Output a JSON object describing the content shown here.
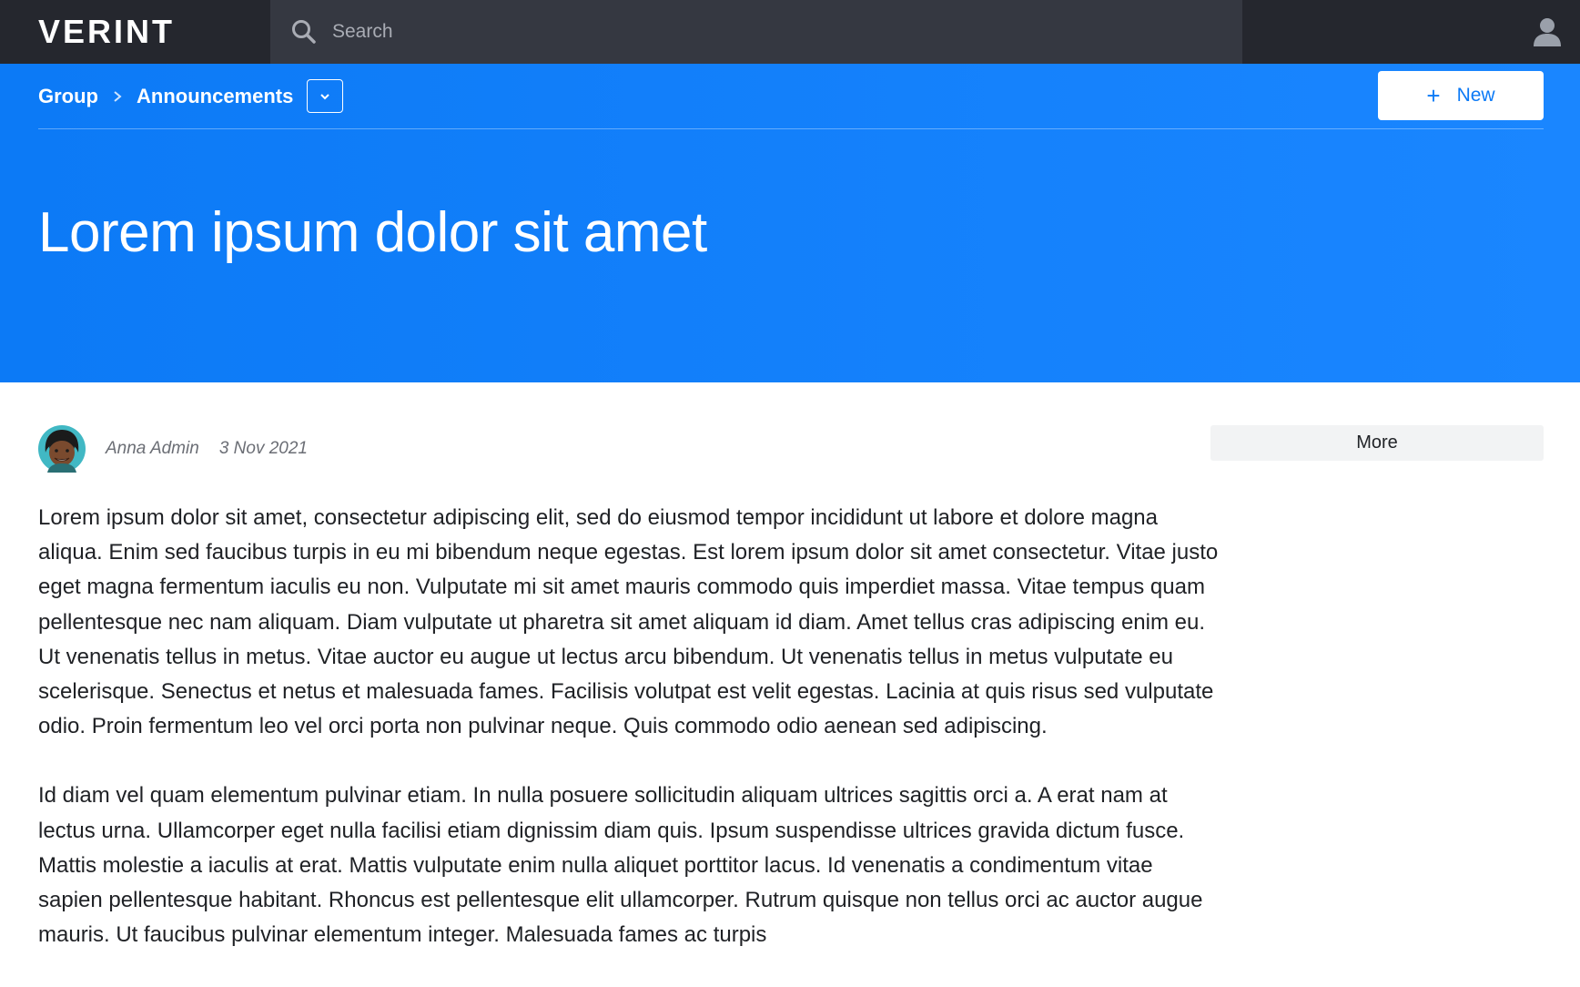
{
  "header": {
    "logo": "VERINT",
    "search": {
      "placeholder": "Search",
      "value": ""
    },
    "user_icon": "user-icon"
  },
  "breadcrumb": {
    "items": [
      "Group",
      "Announcements"
    ],
    "separator_icon": "chevron-right-icon",
    "dropdown_icon": "chevron-down-icon"
  },
  "actions": {
    "new_label": "New",
    "new_icon": "plus-icon",
    "more_label": "More"
  },
  "post": {
    "title": "Lorem ipsum dolor sit amet",
    "author": "Anna Admin",
    "date": "3 Nov 2021",
    "paragraphs": [
      "Lorem ipsum dolor sit amet, consectetur adipiscing elit, sed do eiusmod tempor incididunt ut labore et dolore magna aliqua. Enim sed faucibus turpis in eu mi bibendum neque egestas. Est lorem ipsum dolor sit amet consectetur. Vitae justo eget magna fermentum iaculis eu non. Vulputate mi sit amet mauris commodo quis imperdiet massa. Vitae tempus quam pellentesque nec nam aliquam. Diam vulputate ut pharetra sit amet aliquam id diam. Amet tellus cras adipiscing enim eu. Ut venenatis tellus in metus. Vitae auctor eu augue ut lectus arcu bibendum. Ut venenatis tellus in metus vulputate eu scelerisque. Senectus et netus et malesuada fames. Facilisis volutpat est velit egestas. Lacinia at quis risus sed vulputate odio. Proin fermentum leo vel orci porta non pulvinar neque. Quis commodo odio aenean sed adipiscing.",
      "Id diam vel quam elementum pulvinar etiam. In nulla posuere sollicitudin aliquam ultrices sagittis orci a. A erat nam at lectus urna. Ullamcorper eget nulla facilisi etiam dignissim diam quis. Ipsum suspendisse ultrices gravida dictum fusce. Mattis molestie a iaculis at erat. Mattis vulputate enim nulla aliquet porttitor lacus. Id venenatis a condimentum vitae sapien pellentesque habitant. Rhoncus est pellentesque elit ullamcorper. Rutrum quisque non tellus orci ac auctor augue mauris. Ut faucibus pulvinar elementum integer. Malesuada fames ac turpis"
    ]
  },
  "colors": {
    "topbar": "#25272e",
    "search_bg": "#353841",
    "hero": "#0c7af6",
    "accent": "#0c7af6"
  }
}
